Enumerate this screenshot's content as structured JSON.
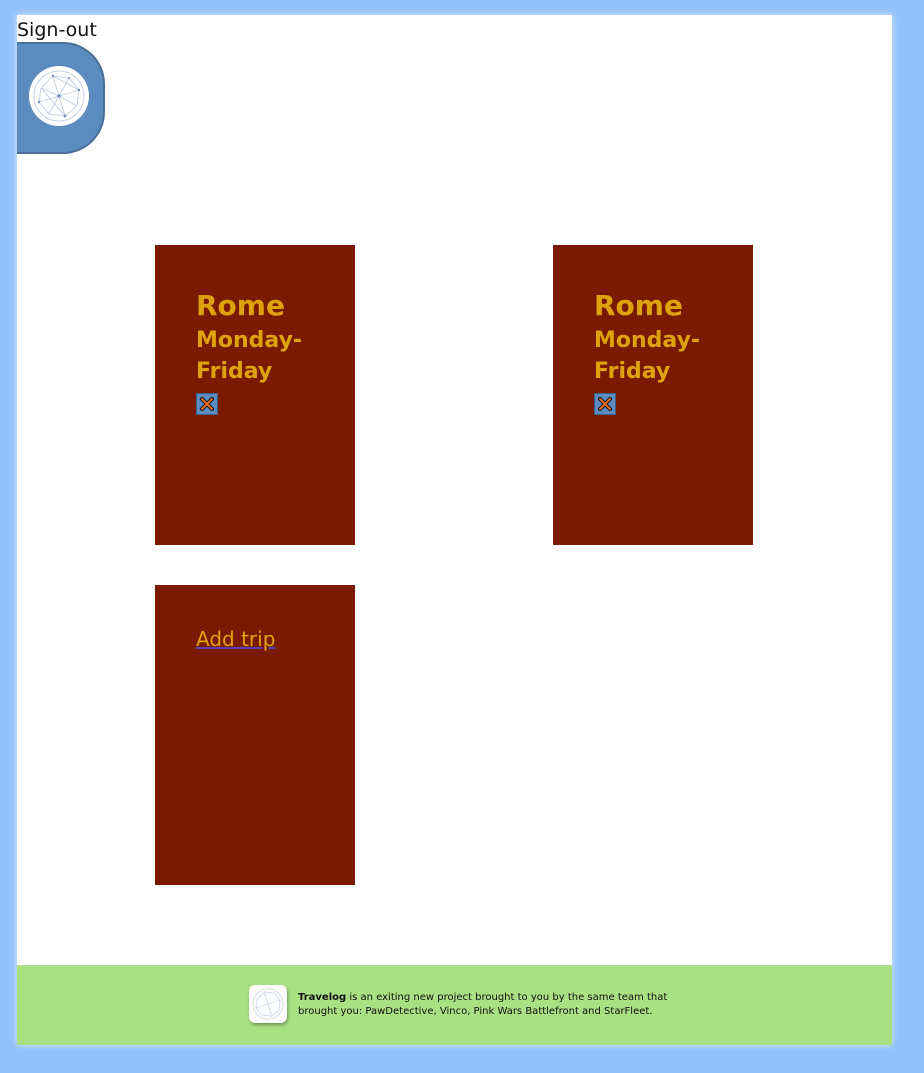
{
  "header": {
    "signout_label": "Sign-out",
    "logo_icon": "globe-network-icon"
  },
  "trips": [
    {
      "city": "Rome",
      "days": "Monday-Friday",
      "delete_icon": "close-x-icon"
    },
    {
      "city": "Rome",
      "days": "Monday-Friday",
      "delete_icon": "close-x-icon"
    }
  ],
  "add_card": {
    "label": "Add trip"
  },
  "footer": {
    "brand": "Travelog",
    "text": " is an exiting new project brought to you by the same team that brought you: PawDetective, Vinco, Pink Wars Battlefront and StarFleet."
  },
  "colors": {
    "background": "#93c2fb",
    "card": "#7a1a00",
    "card_text": "#dfa20d",
    "footer": "#aae084",
    "accent_blue": "#5b8bbf"
  }
}
